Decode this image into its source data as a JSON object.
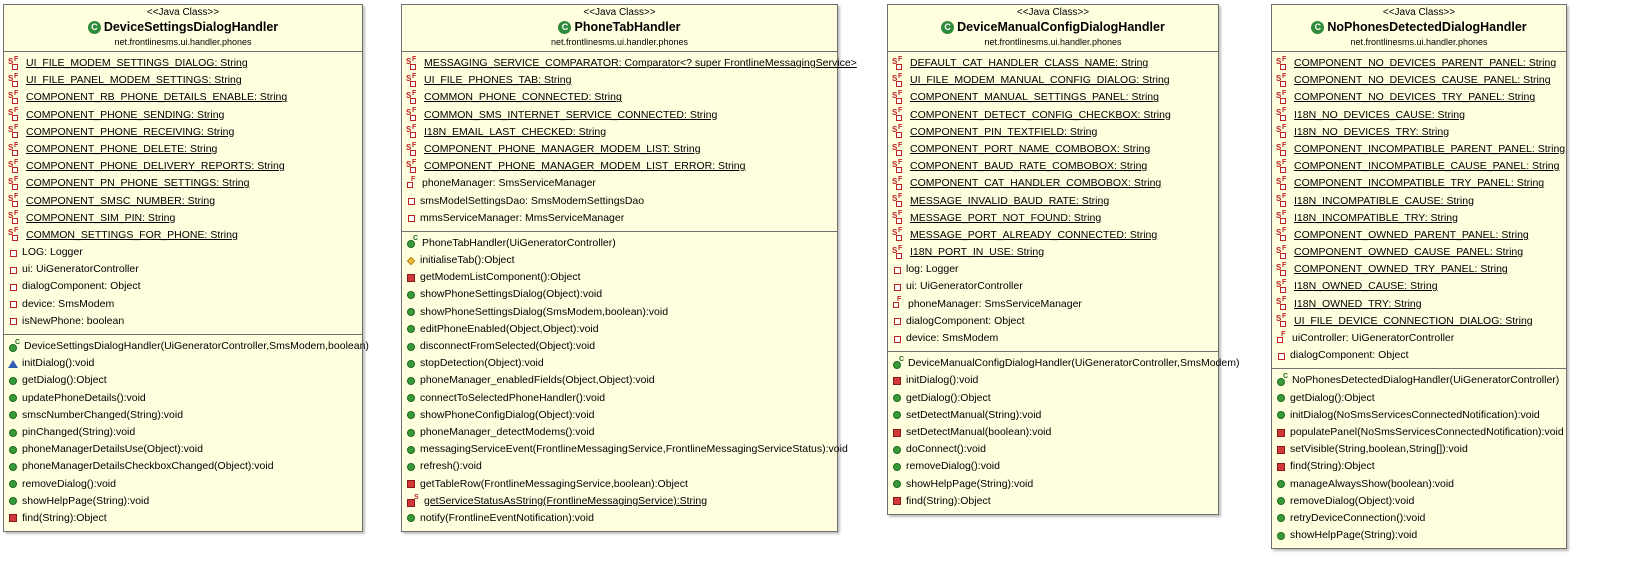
{
  "classes": [
    {
      "stereotype": "<<Java Class>>",
      "name": "DeviceSettingsDialogHandler",
      "package": "net.frontlinesms.ui.handler.phones",
      "fields": [
        {
          "text": "UI_FILE_MODEM_SETTINGS_DIALOG: String",
          "icon": "static-final-private-field-icon"
        },
        {
          "text": "UI_FILE_PANEL_MODEM_SETTINGS: String",
          "icon": "static-final-private-field-icon"
        },
        {
          "text": "COMPONENT_RB_PHONE_DETAILS_ENABLE: String",
          "icon": "static-final-private-field-icon"
        },
        {
          "text": "COMPONENT_PHONE_SENDING: String",
          "icon": "static-final-private-field-icon"
        },
        {
          "text": "COMPONENT_PHONE_RECEIVING: String",
          "icon": "static-final-private-field-icon"
        },
        {
          "text": "COMPONENT_PHONE_DELETE: String",
          "icon": "static-final-private-field-icon"
        },
        {
          "text": "COMPONENT_PHONE_DELIVERY_REPORTS: String",
          "icon": "static-final-private-field-icon"
        },
        {
          "text": "COMPONENT_PN_PHONE_SETTINGS: String",
          "icon": "static-final-private-field-icon"
        },
        {
          "text": "COMPONENT_SMSC_NUMBER: String",
          "icon": "static-final-private-field-icon"
        },
        {
          "text": "COMPONENT_SIM_PIN: String",
          "icon": "static-final-private-field-icon"
        },
        {
          "text": "COMMON_SETTINGS_FOR_PHONE: String",
          "icon": "static-final-private-field-icon"
        },
        {
          "text": "LOG: Logger",
          "icon": "private-field-icon"
        },
        {
          "text": "ui: UiGeneratorController",
          "icon": "private-field-icon"
        },
        {
          "text": "dialogComponent: Object",
          "icon": "private-field-icon"
        },
        {
          "text": "device: SmsModem",
          "icon": "private-field-icon"
        },
        {
          "text": "isNewPhone: boolean",
          "icon": "private-field-icon"
        }
      ],
      "methods": [
        {
          "text": "DeviceSettingsDialogHandler(UiGeneratorController,SmsModem,boolean)",
          "icon": "constructor-icon"
        },
        {
          "text": "initDialog():void",
          "icon": "protected-method-icon"
        },
        {
          "text": "getDialog():Object",
          "icon": "public-method-icon"
        },
        {
          "text": "updatePhoneDetails():void",
          "icon": "public-method-icon"
        },
        {
          "text": "smscNumberChanged(String):void",
          "icon": "public-method-icon"
        },
        {
          "text": "pinChanged(String):void",
          "icon": "public-method-icon"
        },
        {
          "text": "phoneManagerDetailsUse(Object):void",
          "icon": "public-method-icon"
        },
        {
          "text": "phoneManagerDetailsCheckboxChanged(Object):void",
          "icon": "public-method-icon"
        },
        {
          "text": "removeDialog():void",
          "icon": "public-method-icon"
        },
        {
          "text": "showHelpPage(String):void",
          "icon": "public-method-icon"
        },
        {
          "text": "find(String):Object",
          "icon": "private-method-icon"
        }
      ]
    },
    {
      "stereotype": "<<Java Class>>",
      "name": "PhoneTabHandler",
      "package": "net.frontlinesms.ui.handler.phones",
      "fields": [
        {
          "text": "MESSAGING_SERVICE_COMPARATOR: Comparator<? super FrontlineMessagingService>",
          "icon": "static-final-private-field-icon"
        },
        {
          "text": "UI_FILE_PHONES_TAB: String",
          "icon": "static-final-private-field-icon"
        },
        {
          "text": "COMMON_PHONE_CONNECTED: String",
          "icon": "static-final-private-field-icon"
        },
        {
          "text": "COMMON_SMS_INTERNET_SERVICE_CONNECTED: String",
          "icon": "static-final-private-field-icon"
        },
        {
          "text": "I18N_EMAIL_LAST_CHECKED: String",
          "icon": "static-final-private-field-icon"
        },
        {
          "text": "COMPONENT_PHONE_MANAGER_MODEM_LIST: String",
          "icon": "static-final-private-field-icon"
        },
        {
          "text": "COMPONENT_PHONE_MANAGER_MODEM_LIST_ERROR: String",
          "icon": "static-final-private-field-icon"
        },
        {
          "text": "phoneManager: SmsServiceManager",
          "icon": "final-private-field-icon"
        },
        {
          "text": "smsModelSettingsDao: SmsModemSettingsDao",
          "icon": "private-field-icon"
        },
        {
          "text": "mmsServiceManager: MmsServiceManager",
          "icon": "private-field-icon"
        }
      ],
      "methods": [
        {
          "text": "PhoneTabHandler(UiGeneratorController)",
          "icon": "constructor-icon"
        },
        {
          "text": "initialiseTab():Object",
          "icon": "package-method-icon"
        },
        {
          "text": "getModemListComponent():Object",
          "icon": "private-method-icon"
        },
        {
          "text": "showPhoneSettingsDialog(Object):void",
          "icon": "public-method-icon"
        },
        {
          "text": "showPhoneSettingsDialog(SmsModem,boolean):void",
          "icon": "public-method-icon"
        },
        {
          "text": "editPhoneEnabled(Object,Object):void",
          "icon": "public-method-icon"
        },
        {
          "text": "disconnectFromSelected(Object):void",
          "icon": "public-method-icon"
        },
        {
          "text": "stopDetection(Object):void",
          "icon": "public-method-icon"
        },
        {
          "text": "phoneManager_enabledFields(Object,Object):void",
          "icon": "public-method-icon"
        },
        {
          "text": "connectToSelectedPhoneHandler():void",
          "icon": "public-method-icon"
        },
        {
          "text": "showPhoneConfigDialog(Object):void",
          "icon": "public-method-icon"
        },
        {
          "text": "phoneManager_detectModems():void",
          "icon": "public-method-icon"
        },
        {
          "text": "messagingServiceEvent(FrontlineMessagingService,FrontlineMessagingServiceStatus):void",
          "icon": "public-method-icon"
        },
        {
          "text": "refresh():void",
          "icon": "public-method-icon"
        },
        {
          "text": "getTableRow(FrontlineMessagingService,boolean):Object",
          "icon": "private-method-icon"
        },
        {
          "text": "getServiceStatusAsString(FrontlineMessagingService):String",
          "icon": "static-private-method-icon"
        },
        {
          "text": "notify(FrontlineEventNotification):void",
          "icon": "public-method-icon"
        }
      ]
    },
    {
      "stereotype": "<<Java Class>>",
      "name": "DeviceManualConfigDialogHandler",
      "package": "net.frontlinesms.ui.handler.phones",
      "fields": [
        {
          "text": "DEFAULT_CAT_HANDLER_CLASS_NAME: String",
          "icon": "static-final-private-field-icon"
        },
        {
          "text": "UI_FILE_MODEM_MANUAL_CONFIG_DIALOG: String",
          "icon": "static-final-private-field-icon"
        },
        {
          "text": "COMPONENT_MANUAL_SETTINGS_PANEL: String",
          "icon": "static-final-private-field-icon"
        },
        {
          "text": "COMPONENT_DETECT_CONFIG_CHECKBOX: String",
          "icon": "static-final-private-field-icon"
        },
        {
          "text": "COMPONENT_PIN_TEXTFIELD: String",
          "icon": "static-final-private-field-icon"
        },
        {
          "text": "COMPONENT_PORT_NAME_COMBOBOX: String",
          "icon": "static-final-private-field-icon"
        },
        {
          "text": "COMPONENT_BAUD_RATE_COMBOBOX: String",
          "icon": "static-final-private-field-icon"
        },
        {
          "text": "COMPONENT_CAT_HANDLER_COMBOBOX: String",
          "icon": "static-final-private-field-icon"
        },
        {
          "text": "MESSAGE_INVALID_BAUD_RATE: String",
          "icon": "static-final-private-field-icon"
        },
        {
          "text": "MESSAGE_PORT_NOT_FOUND: String",
          "icon": "static-final-private-field-icon"
        },
        {
          "text": "MESSAGE_PORT_ALREADY_CONNECTED: String",
          "icon": "static-final-private-field-icon"
        },
        {
          "text": "I18N_PORT_IN_USE: String",
          "icon": "static-final-private-field-icon"
        },
        {
          "text": "log: Logger",
          "icon": "private-field-icon"
        },
        {
          "text": "ui: UiGeneratorController",
          "icon": "private-field-icon"
        },
        {
          "text": "phoneManager: SmsServiceManager",
          "icon": "final-private-field-icon"
        },
        {
          "text": "dialogComponent: Object",
          "icon": "private-field-icon"
        },
        {
          "text": "device: SmsModem",
          "icon": "private-field-icon"
        }
      ],
      "methods": [
        {
          "text": "DeviceManualConfigDialogHandler(UiGeneratorController,SmsModem)",
          "icon": "constructor-icon"
        },
        {
          "text": "initDialog():void",
          "icon": "private-method-icon"
        },
        {
          "text": "getDialog():Object",
          "icon": "public-method-icon"
        },
        {
          "text": "setDetectManual(String):void",
          "icon": "public-method-icon"
        },
        {
          "text": "setDetectManual(boolean):void",
          "icon": "private-method-icon"
        },
        {
          "text": "doConnect():void",
          "icon": "public-method-icon"
        },
        {
          "text": "removeDialog():void",
          "icon": "public-method-icon"
        },
        {
          "text": "showHelpPage(String):void",
          "icon": "public-method-icon"
        },
        {
          "text": "find(String):Object",
          "icon": "private-method-icon"
        }
      ]
    },
    {
      "stereotype": "<<Java Class>>",
      "name": "NoPhonesDetectedDialogHandler",
      "package": "net.frontlinesms.ui.handler.phones",
      "fields": [
        {
          "text": "COMPONENT_NO_DEVICES_PARENT_PANEL: String",
          "icon": "static-final-private-field-icon"
        },
        {
          "text": "COMPONENT_NO_DEVICES_CAUSE_PANEL: String",
          "icon": "static-final-private-field-icon"
        },
        {
          "text": "COMPONENT_NO_DEVICES_TRY_PANEL: String",
          "icon": "static-final-private-field-icon"
        },
        {
          "text": "I18N_NO_DEVICES_CAUSE: String",
          "icon": "static-final-private-field-icon"
        },
        {
          "text": "I18N_NO_DEVICES_TRY: String",
          "icon": "static-final-private-field-icon"
        },
        {
          "text": "COMPONENT_INCOMPATIBLE_PARENT_PANEL: String",
          "icon": "static-final-private-field-icon"
        },
        {
          "text": "COMPONENT_INCOMPATIBLE_CAUSE_PANEL: String",
          "icon": "static-final-private-field-icon"
        },
        {
          "text": "COMPONENT_INCOMPATIBLE_TRY_PANEL: String",
          "icon": "static-final-private-field-icon"
        },
        {
          "text": "I18N_INCOMPATIBLE_CAUSE: String",
          "icon": "static-final-private-field-icon"
        },
        {
          "text": "I18N_INCOMPATIBLE_TRY: String",
          "icon": "static-final-private-field-icon"
        },
        {
          "text": "COMPONENT_OWNED_PARENT_PANEL: String",
          "icon": "static-final-private-field-icon"
        },
        {
          "text": "COMPONENT_OWNED_CAUSE_PANEL: String",
          "icon": "static-final-private-field-icon"
        },
        {
          "text": "COMPONENT_OWNED_TRY_PANEL: String",
          "icon": "static-final-private-field-icon"
        },
        {
          "text": "I18N_OWNED_CAUSE: String",
          "icon": "static-final-private-field-icon"
        },
        {
          "text": "I18N_OWNED_TRY: String",
          "icon": "static-final-private-field-icon"
        },
        {
          "text": "UI_FILE_DEVICE_CONNECTION_DIALOG: String",
          "icon": "static-final-private-field-icon"
        },
        {
          "text": "uiController: UiGeneratorController",
          "icon": "final-private-field-icon"
        },
        {
          "text": "dialogComponent: Object",
          "icon": "private-field-icon"
        }
      ],
      "methods": [
        {
          "text": "NoPhonesDetectedDialogHandler(UiGeneratorController)",
          "icon": "constructor-icon"
        },
        {
          "text": "getDialog():Object",
          "icon": "public-method-icon"
        },
        {
          "text": "initDialog(NoSmsServicesConnectedNotification):void",
          "icon": "public-method-icon"
        },
        {
          "text": "populatePanel(NoSmsServicesConnectedNotification):void",
          "icon": "private-method-icon"
        },
        {
          "text": "setVisible(String,boolean,String[]):void",
          "icon": "private-method-icon"
        },
        {
          "text": "find(String):Object",
          "icon": "private-method-icon"
        },
        {
          "text": "manageAlwaysShow(boolean):void",
          "icon": "public-method-icon"
        },
        {
          "text": "removeDialog(Object):void",
          "icon": "public-method-icon"
        },
        {
          "text": "retryDeviceConnection():void",
          "icon": "public-method-icon"
        },
        {
          "text": "showHelpPage(String):void",
          "icon": "public-method-icon"
        }
      ]
    }
  ]
}
